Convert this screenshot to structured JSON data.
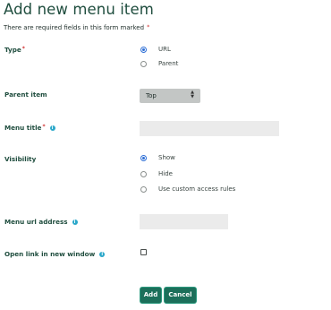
{
  "title": "Add new menu item",
  "required_note": "There are required fields in this form marked",
  "required_marker": "*",
  "info_icon_glyph": "i",
  "colors": {
    "accent": "#1c6f5a",
    "heading": "#1f4d3e",
    "required": "#d0302f",
    "info": "#2aa7c9",
    "radio_selected": "#2e6fd6"
  },
  "type": {
    "label": "Type",
    "options": [
      {
        "label": "URL",
        "selected": true
      },
      {
        "label": "Parent",
        "selected": false
      }
    ]
  },
  "parent_item": {
    "label": "Parent item",
    "value": "Top",
    "arrow_up": "▲",
    "arrow_down": "▼"
  },
  "menu_title": {
    "label": "Menu title",
    "value": "",
    "placeholder": ""
  },
  "visibility": {
    "label": "Visibility",
    "options": [
      {
        "label": "Show",
        "selected": true
      },
      {
        "label": "Hide",
        "selected": false
      },
      {
        "label": "Use custom access rules",
        "selected": false
      }
    ]
  },
  "menu_url": {
    "label": "Menu url address",
    "value": "",
    "placeholder": ""
  },
  "new_window": {
    "label": "Open link in new window",
    "checked": false
  },
  "buttons": {
    "add": "Add",
    "cancel": "Cancel"
  }
}
